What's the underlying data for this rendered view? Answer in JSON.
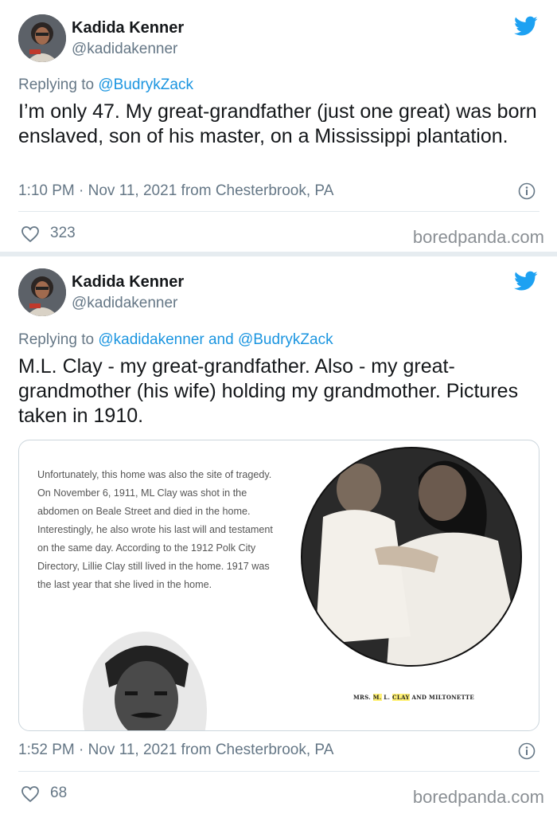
{
  "tweets": [
    {
      "author": {
        "name": "Kadida Kenner",
        "handle": "@kadidakenner"
      },
      "replying": {
        "prefix": "Replying to ",
        "mentions": "@BudrykZack"
      },
      "text": "I’m only 47. My great-grandfather (just one great) was born enslaved, son of his master, on a Mississippi plantation.",
      "timestamp": "1:10 PM · Nov 11, 2021 from Chesterbrook, PA",
      "likes": "323",
      "watermark": "boredpanda.com"
    },
    {
      "author": {
        "name": "Kadida Kenner",
        "handle": "@kadidakenner"
      },
      "replying": {
        "prefix": "Replying to ",
        "mentions": "@kadidakenner and @BudrykZack"
      },
      "text": "M.L. Clay - my great-grandfather. Also - my great-grandmother (his wife) holding my grandmother. Pictures taken in 1910.",
      "media": {
        "article_text": "Unfortunately, this home was also the site of tragedy. On November 6, 1911, ML Clay was shot in the abdomen on Beale Street and died in the home. Interestingly, he also wrote his last will and testament on the same day. According to the 1912 Polk City Directory, Lillie Clay still lived in the home. 1917 was the last year that she lived in the home.",
        "caption_parts": [
          "MRS. ",
          "M.",
          " L. ",
          "CLAY",
          " AND MILTONETTE"
        ]
      },
      "timestamp": "1:52 PM · Nov 11, 2021 from Chesterbrook, PA",
      "likes": "68",
      "watermark": "boredpanda.com"
    }
  ],
  "colors": {
    "accent": "#1b95e0",
    "secondary_text": "#657786",
    "divider": "#e1e8ed"
  },
  "icons": [
    "twitter-bird-icon",
    "info-icon",
    "heart-icon"
  ]
}
